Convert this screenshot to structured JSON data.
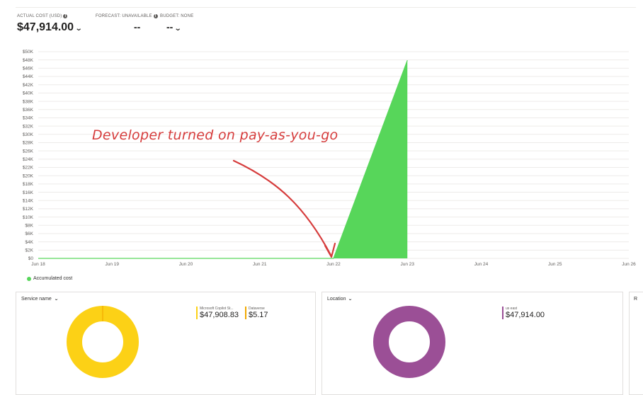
{
  "kpis": {
    "actual_cost": {
      "label": "ACTUAL COST (USD)",
      "value": "$47,914.00"
    },
    "forecast": {
      "label": "FORECAST: UNAVAILABLE",
      "value": "--"
    },
    "budget": {
      "label": "BUDGET: NONE",
      "value": "--"
    }
  },
  "chart_data": {
    "type": "area",
    "y_ticks": [
      "$0",
      "$2K",
      "$4K",
      "$6K",
      "$8K",
      "$10K",
      "$12K",
      "$14K",
      "$16K",
      "$18K",
      "$20K",
      "$22K",
      "$24K",
      "$26K",
      "$28K",
      "$30K",
      "$32K",
      "$34K",
      "$36K",
      "$38K",
      "$40K",
      "$42K",
      "$44K",
      "$46K",
      "$48K",
      "$50K"
    ],
    "ylim": [
      0,
      50000
    ],
    "x_ticks": [
      "Jun 18",
      "Jun 19",
      "Jun 20",
      "Jun 21",
      "Jun 22",
      "Jun 23",
      "Jun 24",
      "Jun 25",
      "Jun 26"
    ],
    "series": [
      {
        "name": "Accumulated cost",
        "color": "#57d65a",
        "points": [
          [
            "Jun 18",
            0
          ],
          [
            "Jun 19",
            0
          ],
          [
            "Jun 20",
            0
          ],
          [
            "Jun 21",
            0
          ],
          [
            "Jun 22",
            0
          ],
          [
            "Jun 23",
            47914
          ]
        ]
      }
    ],
    "grid": true,
    "legend": "bottom-left"
  },
  "annotation": {
    "text": "Developer turned on pay-as-you-go",
    "color": "#d63c3c"
  },
  "panels": {
    "service": {
      "header": "Service name",
      "items": [
        {
          "label": "Microsoft Copilot St...",
          "value": "$47,908.83",
          "color": "#fcd116"
        },
        {
          "label": "Dataverse",
          "value": "$5.17",
          "color": "#f2a900"
        }
      ]
    },
    "location": {
      "header": "Location",
      "items": [
        {
          "label": "us east",
          "value": "$47,914.00",
          "color": "#9b4f96"
        }
      ]
    },
    "third": {
      "header": "R"
    }
  }
}
